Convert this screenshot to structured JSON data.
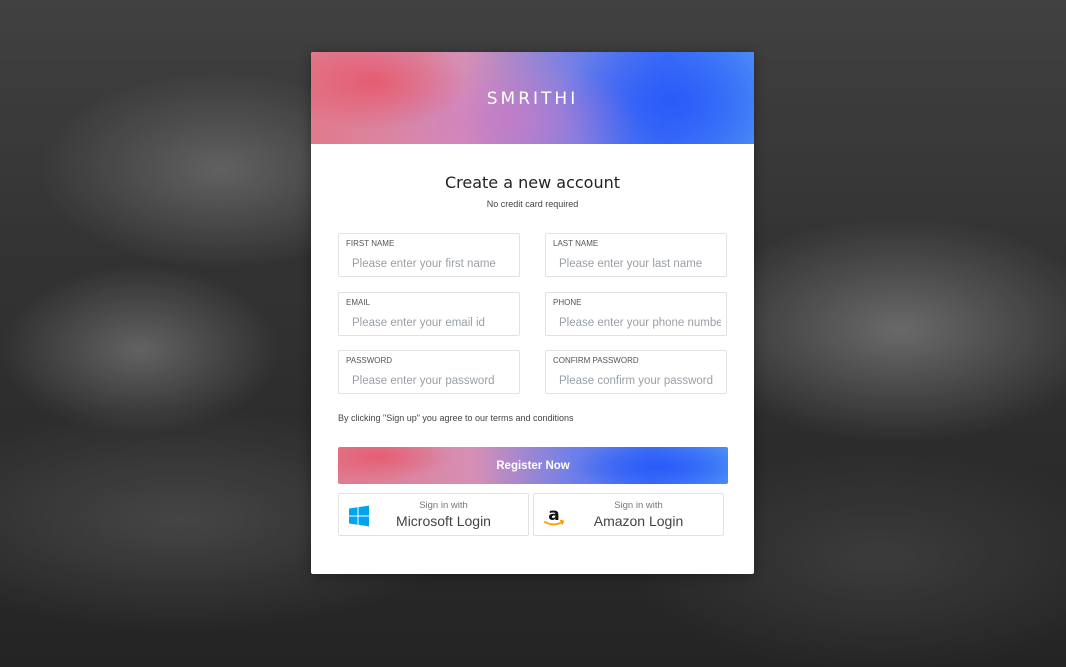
{
  "brand": {
    "name": "SMRITHI"
  },
  "heading": {
    "title": "Create a new account",
    "subtitle": "No credit card required"
  },
  "form": {
    "first_name": {
      "label": "FIRST NAME",
      "placeholder": "Please enter your first name",
      "value": ""
    },
    "last_name": {
      "label": "LAST NAME",
      "placeholder": "Please enter your last name",
      "value": ""
    },
    "email": {
      "label": "EMAIL",
      "placeholder": "Please enter your email id",
      "value": ""
    },
    "phone": {
      "label": "PHONE",
      "placeholder": "Please enter your phone number",
      "value": ""
    },
    "password": {
      "label": "PASSWORD",
      "placeholder": "Please enter your password",
      "value": ""
    },
    "confirm_password": {
      "label": "CONFIRM PASSWORD",
      "placeholder": "Please confirm your password",
      "value": ""
    }
  },
  "terms": "By clicking \"Sign up\" you agree to our terms and conditions",
  "register_label": "Register Now",
  "social": {
    "microsoft": {
      "prefix": "Sign in with",
      "label": "Microsoft Login",
      "icon": "windows-icon"
    },
    "amazon": {
      "prefix": "Sign in with",
      "label": "Amazon Login",
      "icon": "amazon-icon"
    }
  },
  "colors": {
    "accent_pink": "#e07a8d",
    "accent_blue": "#3d6ff5",
    "windows_blue": "#00a4ef",
    "amazon_orange": "#ff9900"
  }
}
